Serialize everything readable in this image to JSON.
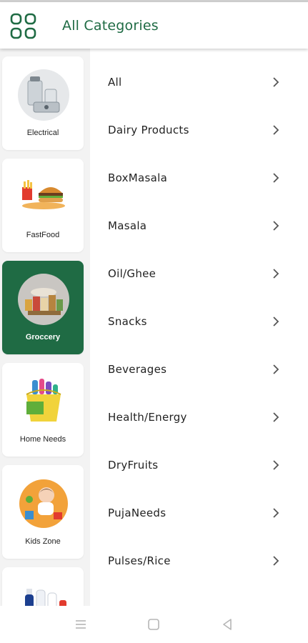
{
  "app": {
    "title": "All Categories",
    "accent": "#1f6b44"
  },
  "sidebar": {
    "items": [
      {
        "label": "Electrical",
        "icon": "mixer-grinder-image",
        "selected": false
      },
      {
        "label": "FastFood",
        "icon": "burger-fries-image",
        "selected": false
      },
      {
        "label": "Groccery",
        "icon": "grocery-items-image",
        "selected": true
      },
      {
        "label": "Home Needs",
        "icon": "cleaning-bucket-image",
        "selected": false
      },
      {
        "label": "Kids Zone",
        "icon": "kid-toys-image",
        "selected": false
      },
      {
        "label": "",
        "icon": "personal-care-bottles-image",
        "selected": false
      }
    ]
  },
  "subcategories": [
    {
      "label": "All"
    },
    {
      "label": "Dairy Products"
    },
    {
      "label": "BoxMasala"
    },
    {
      "label": "Masala"
    },
    {
      "label": "Oil/Ghee"
    },
    {
      "label": "Snacks"
    },
    {
      "label": "Beverages"
    },
    {
      "label": "Health/Energy"
    },
    {
      "label": "DryFruits"
    },
    {
      "label": "PujaNeeds"
    },
    {
      "label": "Pulses/Rice"
    }
  ],
  "navbar": {
    "icons": [
      "menu-icon",
      "home-square-icon",
      "back-triangle-icon"
    ]
  }
}
